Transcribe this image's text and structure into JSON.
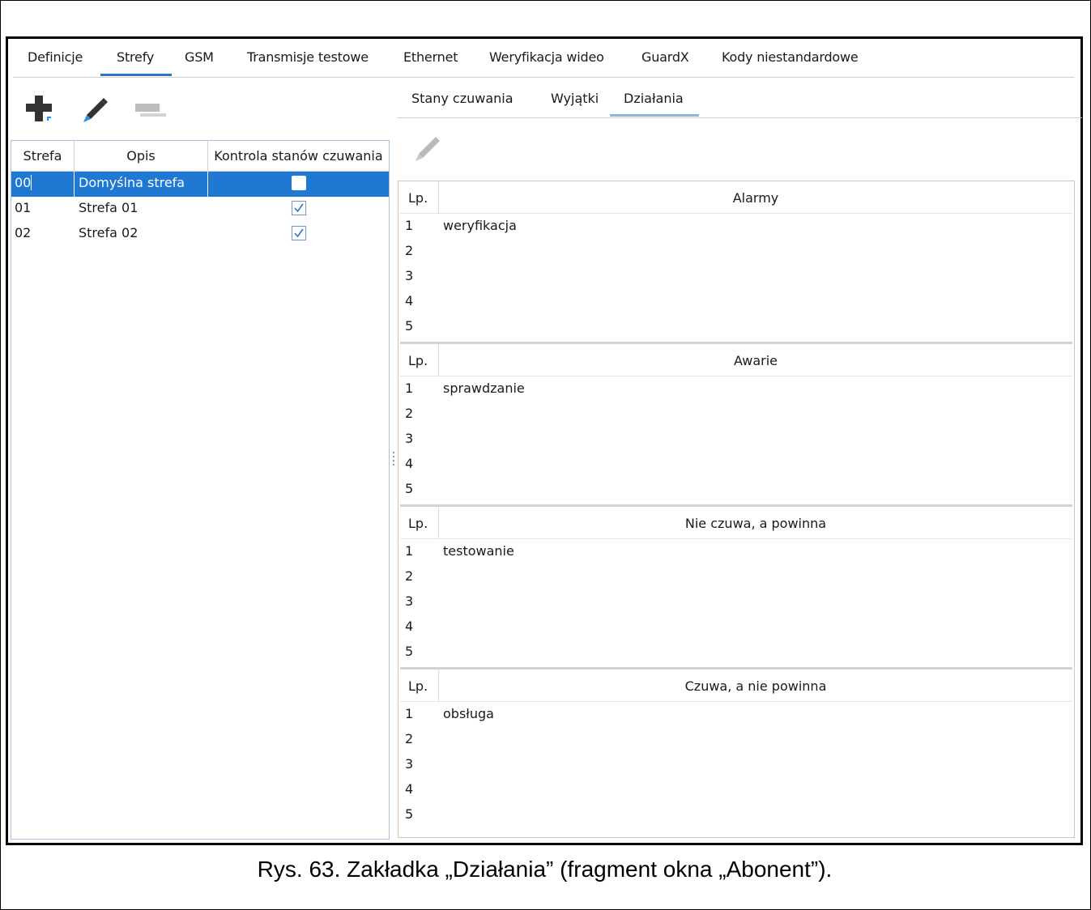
{
  "main_tabs": [
    "Definicje",
    "Strefy",
    "GSM",
    "Transmisje testowe",
    "Ethernet",
    "Weryfikacja wideo",
    "GuardX",
    "Kody niestandardowe"
  ],
  "active_main_tab": "Strefy",
  "toolbar": {
    "add_icon": "add-zone-icon",
    "edit_icon": "pencil-icon",
    "delete_icon": "delete-icon"
  },
  "zones_table": {
    "headers": [
      "Strefa",
      "Opis",
      "Kontrola stanów czuwania"
    ],
    "rows": [
      {
        "strefa": "00",
        "opis": "Domyślna strefa",
        "kontrola": false,
        "selected": true
      },
      {
        "strefa": "01",
        "opis": "Strefa 01",
        "kontrola": true,
        "selected": false
      },
      {
        "strefa": "02",
        "opis": "Strefa 02",
        "kontrola": true,
        "selected": false
      }
    ]
  },
  "sub_tabs": [
    "Stany czuwania",
    "Wyjątki",
    "Działania"
  ],
  "active_sub_tab": "Działania",
  "right_toolbar": {
    "edit_icon": "pencil-icon"
  },
  "sections": [
    {
      "lp_header": "Lp.",
      "title": "Alarmy",
      "rows": [
        {
          "n": "1",
          "v": "weryfikacja"
        },
        {
          "n": "2",
          "v": ""
        },
        {
          "n": "3",
          "v": ""
        },
        {
          "n": "4",
          "v": ""
        },
        {
          "n": "5",
          "v": ""
        }
      ]
    },
    {
      "lp_header": "Lp.",
      "title": "Awarie",
      "rows": [
        {
          "n": "1",
          "v": "sprawdzanie"
        },
        {
          "n": "2",
          "v": ""
        },
        {
          "n": "3",
          "v": ""
        },
        {
          "n": "4",
          "v": ""
        },
        {
          "n": "5",
          "v": ""
        }
      ]
    },
    {
      "lp_header": "Lp.",
      "title": "Nie czuwa, a powinna",
      "rows": [
        {
          "n": "1",
          "v": "testowanie"
        },
        {
          "n": "2",
          "v": ""
        },
        {
          "n": "3",
          "v": ""
        },
        {
          "n": "4",
          "v": ""
        },
        {
          "n": "5",
          "v": ""
        }
      ]
    },
    {
      "lp_header": "Lp.",
      "title": "Czuwa, a nie powinna",
      "rows": [
        {
          "n": "1",
          "v": "obsługa"
        },
        {
          "n": "2",
          "v": ""
        },
        {
          "n": "3",
          "v": ""
        },
        {
          "n": "4",
          "v": ""
        },
        {
          "n": "5",
          "v": ""
        }
      ]
    }
  ],
  "caption": "Rys. 63. Zakładka „Działania” (fragment okna „Abonent”).",
  "colors": {
    "accent": "#2f75c0",
    "selection": "#1f78d1",
    "subtab_underline": "#8fb4da"
  }
}
